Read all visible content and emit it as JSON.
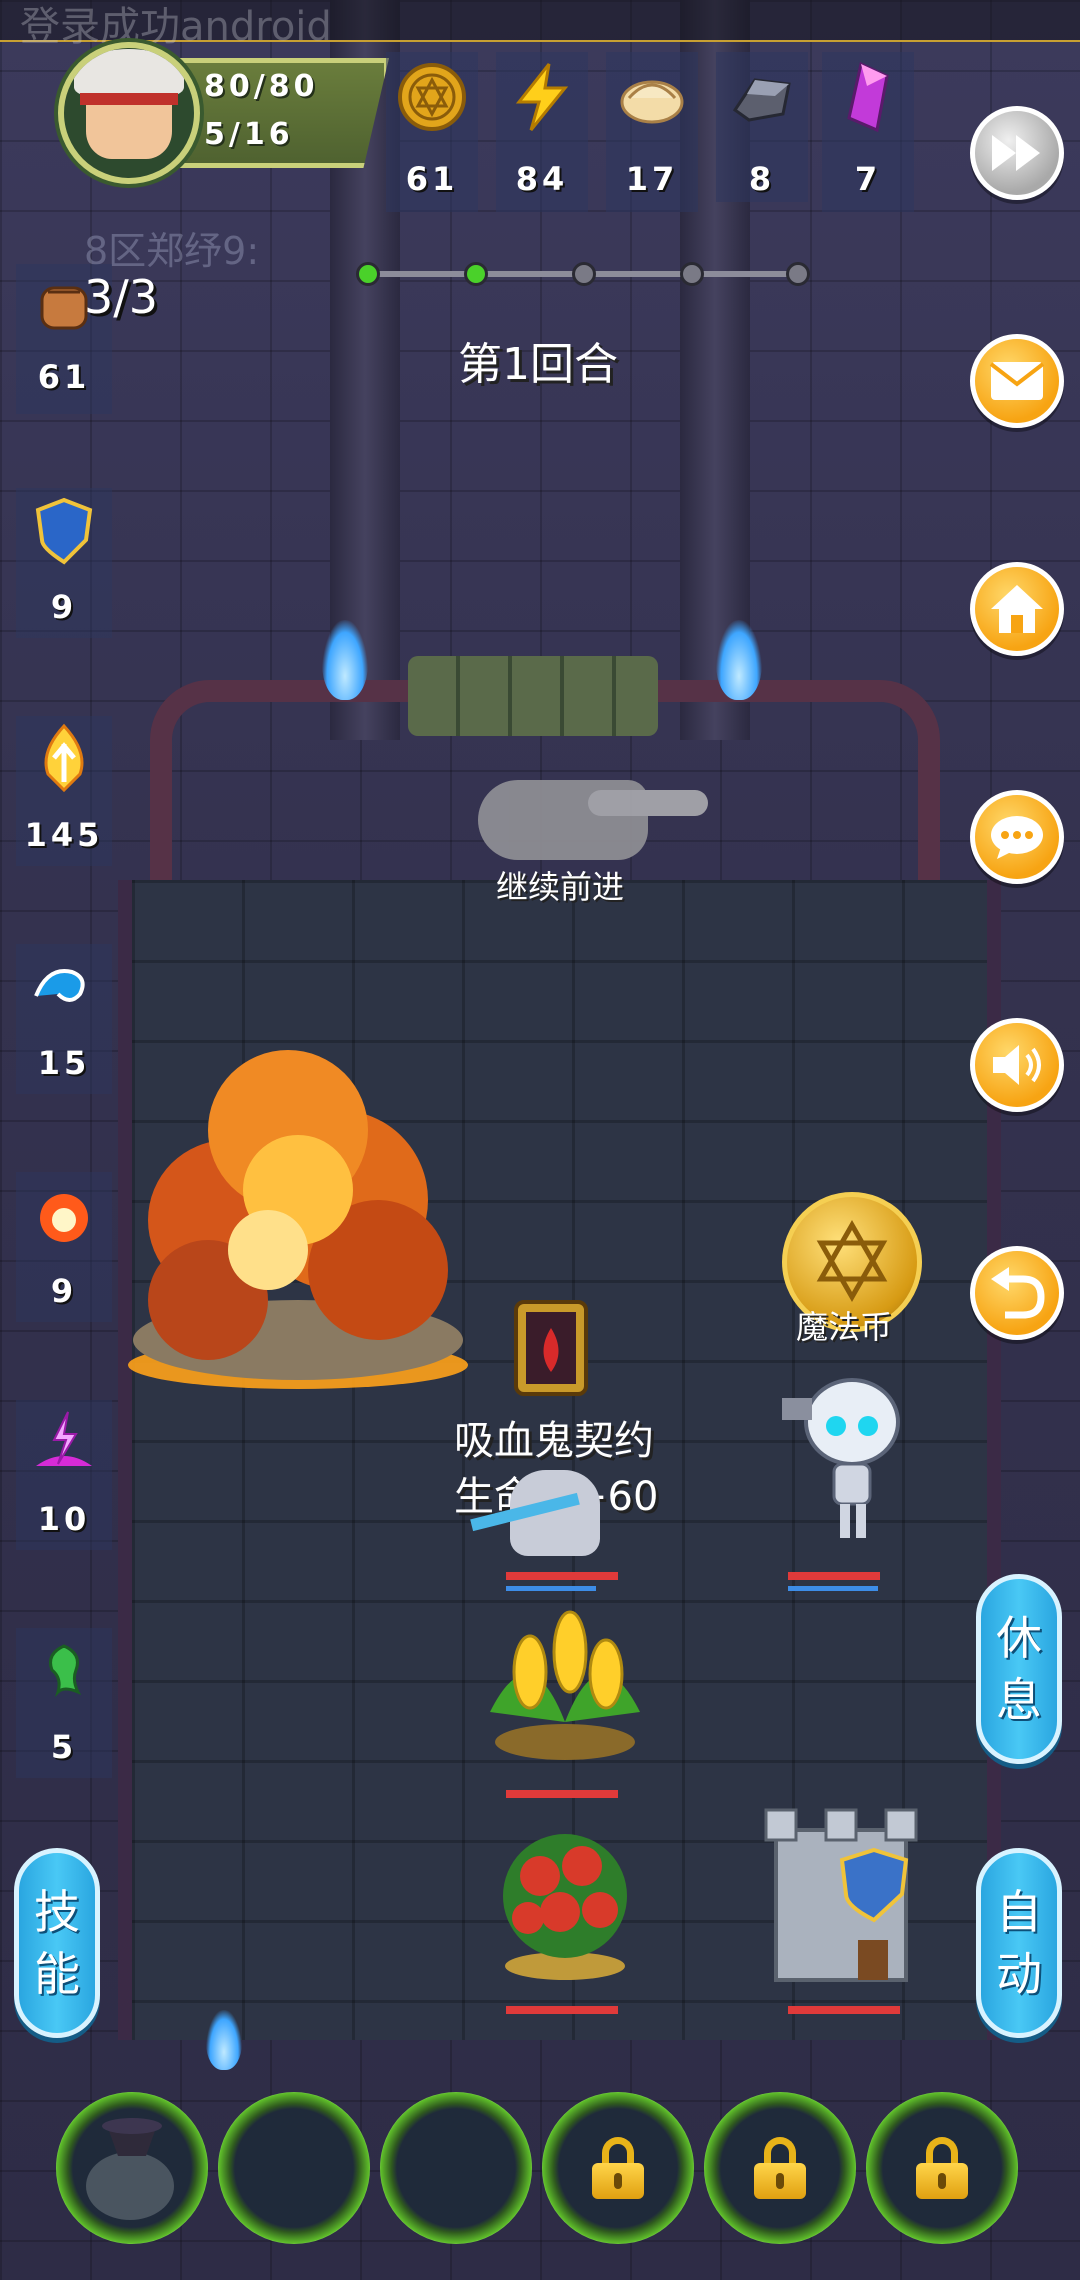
{
  "toast": "登录成功android",
  "player": {
    "hp": "80/80",
    "level": "5/16",
    "name": "8区郑纾9:"
  },
  "resources": [
    {
      "icon": "coin-icon",
      "value": "61"
    },
    {
      "icon": "lightning-icon",
      "value": "84"
    },
    {
      "icon": "dumpling-icon",
      "value": "17"
    },
    {
      "icon": "iron-ore-icon",
      "value": "8"
    },
    {
      "icon": "crystal-icon",
      "value": "7"
    }
  ],
  "side_stats": [
    {
      "icon": "fist-icon",
      "value": "61",
      "extra": "3/3"
    },
    {
      "icon": "shield-icon",
      "value": "9"
    },
    {
      "icon": "fire-arrow-icon",
      "value": "145"
    },
    {
      "icon": "water-wave-icon",
      "value": "15"
    },
    {
      "icon": "fireball-icon",
      "value": "9"
    },
    {
      "icon": "lightning-rune-icon",
      "value": "10"
    },
    {
      "icon": "poison-icon",
      "value": "5"
    }
  ],
  "round": {
    "label": "第1回合",
    "stages_total": 5,
    "stages_done": 2
  },
  "continue_label": "继续前进",
  "events": {
    "item_name": "吸血鬼契约",
    "item_effect": "生命值+60",
    "coin_label": "魔法币"
  },
  "buttons": {
    "rest": [
      "休",
      "息"
    ],
    "skill": [
      "技",
      "能"
    ],
    "auto": [
      "自",
      "动"
    ]
  },
  "right_buttons": [
    {
      "icon": "fast-forward-icon"
    },
    {
      "icon": "mail-icon"
    },
    {
      "icon": "home-icon"
    },
    {
      "icon": "chat-icon"
    },
    {
      "icon": "sound-icon"
    },
    {
      "icon": "return-icon"
    }
  ],
  "skill_slots": [
    {
      "state": "item",
      "icon": "loot-bag-icon"
    },
    {
      "state": "empty"
    },
    {
      "state": "empty"
    },
    {
      "state": "locked"
    },
    {
      "state": "locked"
    },
    {
      "state": "locked"
    }
  ],
  "colors": {
    "accent_orange": "#f7a413",
    "accent_blue": "#2aa6e0",
    "hp_red": "#e03a3a",
    "progress_green": "#4ad12a"
  }
}
